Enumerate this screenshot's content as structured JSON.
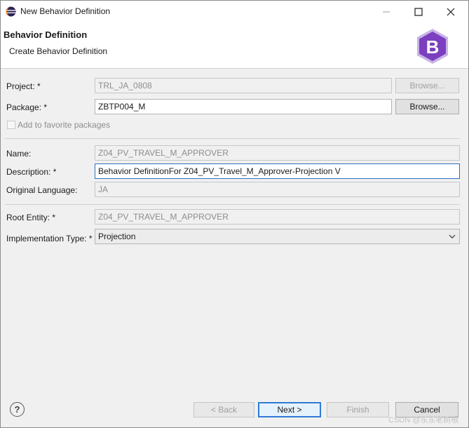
{
  "window": {
    "title": "New Behavior Definition"
  },
  "banner": {
    "title": "Behavior Definition",
    "subtitle": "Create Behavior Definition",
    "logo_letter": "B"
  },
  "form": {
    "project": {
      "label": "Project: *",
      "value": "TRL_JA_0808",
      "browse": "Browse..."
    },
    "package": {
      "label": "Package: *",
      "value": "ZBTP004_M",
      "browse": "Browse..."
    },
    "favorite": {
      "label": "Add to favorite packages"
    },
    "name": {
      "label": "Name:",
      "value": "Z04_PV_TRAVEL_M_APPROVER"
    },
    "description": {
      "label": "Description: *",
      "value": "Behavior DefinitionFor Z04_PV_Travel_M_Approver-Projection V"
    },
    "original_language": {
      "label": "Original Language:",
      "value": "JA"
    },
    "root_entity": {
      "label": "Root Entity: *",
      "value": "Z04_PV_TRAVEL_M_APPROVER"
    },
    "implementation_type": {
      "label": "Implementation Type: *",
      "value": "Projection"
    }
  },
  "footer": {
    "back": "< Back",
    "next": "Next >",
    "finish": "Finish",
    "cancel": "Cancel",
    "help": "?",
    "watermark": "CSDN @东东老树根"
  },
  "colors": {
    "focus": "#2d6fc4",
    "logo_purple": "#7b3fbf",
    "primary_button": "#2f7bd4"
  }
}
